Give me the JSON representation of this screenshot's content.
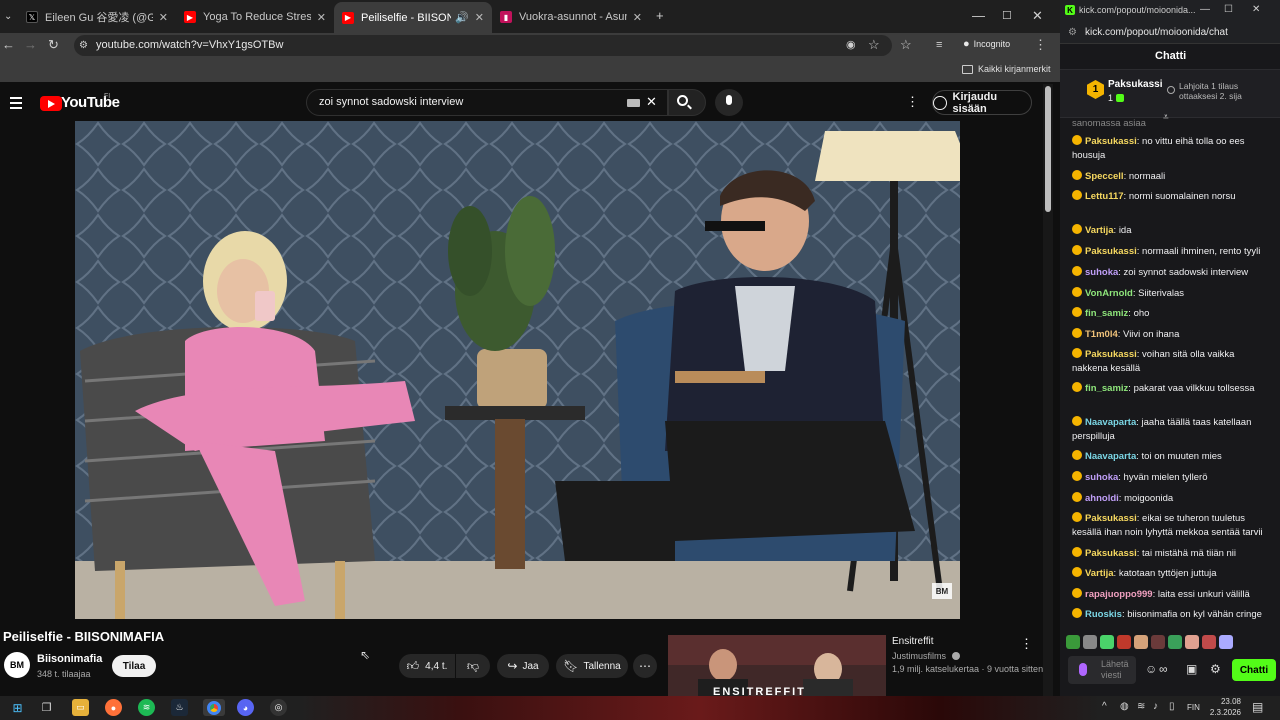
{
  "browser": {
    "tabs": [
      {
        "title": "Eileen Gu 谷愛凌 (@GoEileenGu)",
        "icon": "x-logo-icon",
        "color": "#000000"
      },
      {
        "title": "Yoga To Reduce Stress | 30 Minute",
        "icon": "youtube-icon",
        "color": "#ff0000"
      },
      {
        "title": "Peiliselfie - BIISONIMAFIA - YouTube",
        "icon": "youtube-icon",
        "color": "#ff0000",
        "active": true,
        "audio": true
      },
      {
        "title": "Vuokra-asunnot - Asuntohaku",
        "icon": "oikotie-icon",
        "color": "#c1125b"
      }
    ],
    "new_tab": "+",
    "url": "youtube.com/watch?v=VhxY1gsOTBw",
    "incognito_label": "Incognito",
    "bookmarks_label": "Kaikki kirjanmerkit"
  },
  "youtube": {
    "logo_text": "YouTube",
    "region": "FI",
    "search_query": "zoi synnot sadowski interview",
    "signin_label": "Kirjaudu sisään",
    "video_watermark": "BM",
    "video_title": "Peiliselfie - BIISONIMAFIA",
    "channel": {
      "name": "Biisonimafia",
      "subscribers": "348 t. tilaajaa",
      "avatar": "BM"
    },
    "subscribe_label": "Tilaa",
    "likes": "4,4 t.",
    "share_label": "Jaa",
    "save_label": "Tallenna",
    "recommended": {
      "title": "Ensitreffit",
      "channel": "Justimusfilms",
      "meta": "1,9 milj. katselukertaa · 9 vuotta sitten",
      "thumb_text": "ENSITREFFIT"
    }
  },
  "chat_window": {
    "title_url": "kick.com/popout/moioonida...",
    "address": "kick.com/popout/moioonida/chat",
    "header": "Chatti",
    "pinned_gifter": {
      "rank": "1",
      "name": "Paksukassi",
      "count": "1"
    },
    "pinned_promo": "Lahjoita 1 tilaus ottaaksesi 2. sija",
    "partial_line": "sanomassa asiaa",
    "messages": [
      {
        "user": "Paksukassi",
        "text": "no vittu eihä tolla oo ees housuja",
        "color": "#f6d860"
      },
      {
        "user": "Speccell",
        "text": "normaali",
        "color": "#f6d860"
      },
      {
        "user": "Lettu117",
        "text": "normi suomalainen norsu",
        "color": "#f6d860"
      },
      {
        "user": "Vartija",
        "text": "ida",
        "color": "#f6d860"
      },
      {
        "user": "Paksukassi",
        "text": "normaali ihminen, rento tyyli",
        "color": "#f6d860"
      },
      {
        "user": "suhoka",
        "text": "zoi synnot sadowski interview",
        "color": "#c09ff8"
      },
      {
        "user": "VonArnold",
        "text": "Siiterivalas",
        "color": "#8ee57b"
      },
      {
        "user": "fin_samiz",
        "text": "oho",
        "color": "#8ee57b"
      },
      {
        "user": "T1m0l4",
        "text": "Viivi on ihana",
        "color": "#f0c27a"
      },
      {
        "user": "Paksukassi",
        "text": "voihan sitä olla vaikka nakkena kesällä",
        "color": "#f6d860"
      },
      {
        "user": "fin_samiz",
        "text": "pakarat vaa vilkkuu tollsessa",
        "color": "#8ee57b"
      },
      {
        "user": "Naavaparta",
        "text": "jaaha täällä taas katellaan perspilluja",
        "color": "#7bd6e5"
      },
      {
        "user": "Naavaparta",
        "text": "toi on muuten mies",
        "color": "#7bd6e5"
      },
      {
        "user": "suhoka",
        "text": "hyvän mielen tyllerö",
        "color": "#c09ff8"
      },
      {
        "user": "ahnoldi",
        "text": "moigoonida",
        "color": "#c09ff8"
      },
      {
        "user": "Paksukassi",
        "text": "eikai se tuheron tuuletus kesällä ihan noin lyhyttä mekkoa sentää tarvii",
        "color": "#f6d860"
      },
      {
        "user": "Paksukassi",
        "text": "tai mistähä mä tiiän nii",
        "color": "#f6d860"
      },
      {
        "user": "Vartija",
        "text": "katotaan tyttöjen juttuja",
        "color": "#f6d860"
      },
      {
        "user": "rapajuoppo999",
        "text": "laita essi unkuri välillä",
        "color": "#f0a0c0"
      },
      {
        "user": "Ruoskis",
        "text": "biisonimafia on kyl vähän cringe",
        "color": "#7bd6e5"
      }
    ],
    "input_placeholder": "Lähetä viesti",
    "send_label": "Chatti",
    "accent": "#53fc18"
  },
  "taskbar": {
    "language": "FIN",
    "time": "23.08",
    "date": "2.3.2026"
  }
}
